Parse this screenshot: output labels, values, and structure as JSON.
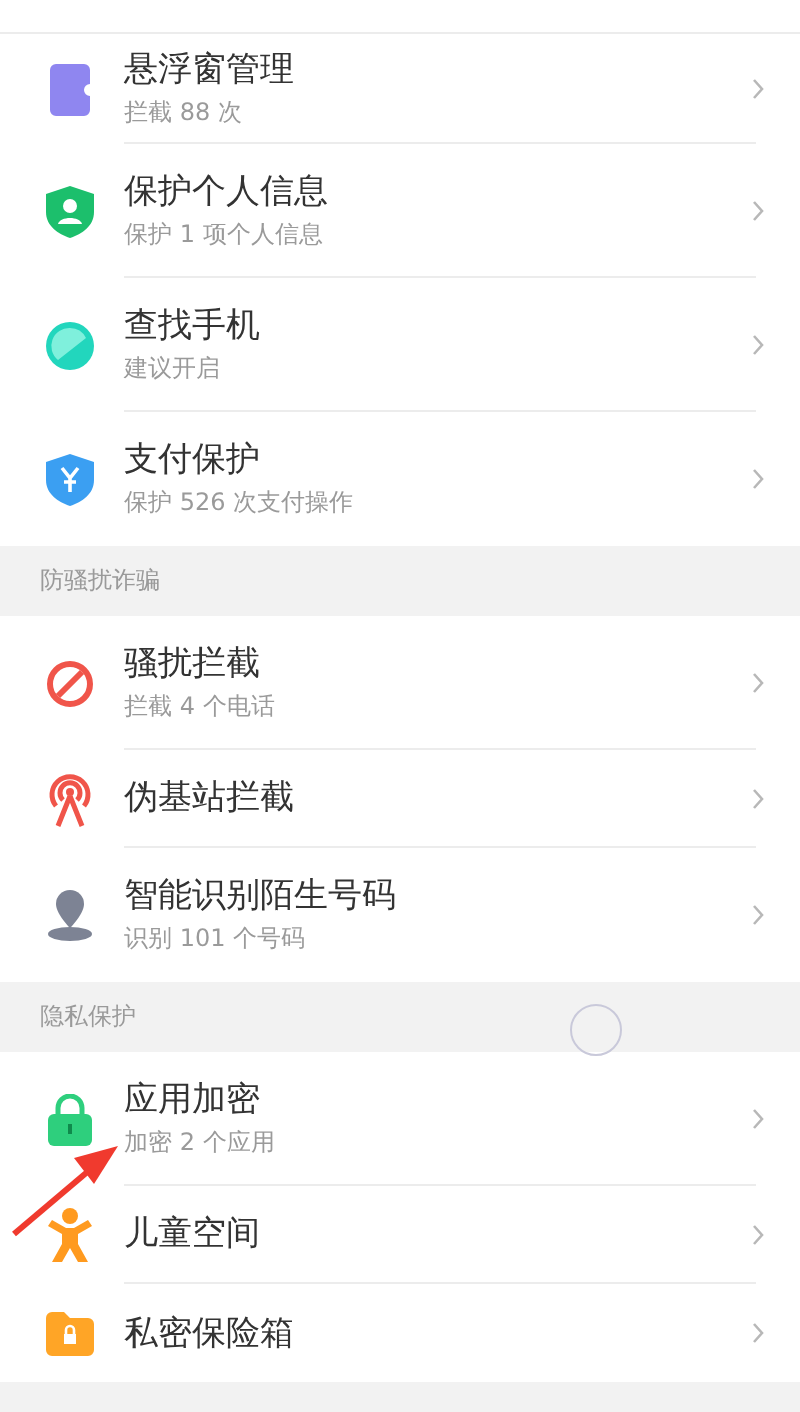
{
  "sections": [
    {
      "items": [
        {
          "title": "悬浮窗管理",
          "subtitle": "拦截 88 次"
        },
        {
          "title": "保护个人信息",
          "subtitle": "保护 1 项个人信息"
        },
        {
          "title": "查找手机",
          "subtitle": "建议开启"
        },
        {
          "title": "支付保护",
          "subtitle": "保护 526 次支付操作"
        }
      ]
    },
    {
      "header": "防骚扰诈骗",
      "items": [
        {
          "title": "骚扰拦截",
          "subtitle": "拦截 4 个电话"
        },
        {
          "title": "伪基站拦截"
        },
        {
          "title": "智能识别陌生号码",
          "subtitle": "识别 101 个号码"
        }
      ]
    },
    {
      "header": "隐私保护",
      "items": [
        {
          "title": "应用加密",
          "subtitle": "加密 2 个应用"
        },
        {
          "title": "儿童空间"
        },
        {
          "title": "私密保险箱"
        }
      ]
    }
  ]
}
